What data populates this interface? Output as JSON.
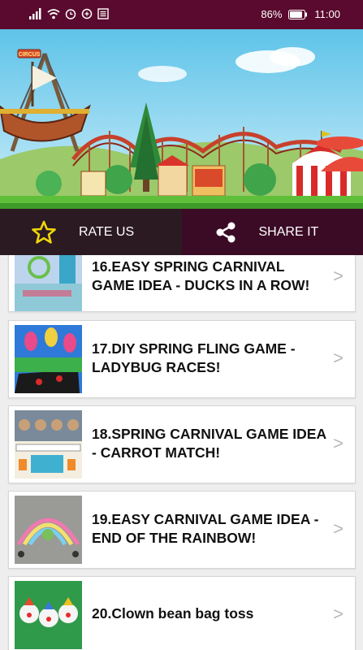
{
  "status_bar": {
    "battery": "86%",
    "time": "11:00"
  },
  "banner": {
    "sign_text": "CIRCUS"
  },
  "actions": {
    "rate_label": "RATE US",
    "share_label": "SHARE IT"
  },
  "items": [
    {
      "title": "16.EASY SPRING CARNIVAL GAME IDEA - DUCKS IN A ROW!",
      "chevron": ">"
    },
    {
      "title": "17.DIY SPRING FLING GAME - LADYBUG RACES!",
      "chevron": ">"
    },
    {
      "title": "18.SPRING CARNIVAL GAME IDEA - CARROT MATCH!",
      "chevron": ">"
    },
    {
      "title": "19.EASY CARNIVAL GAME IDEA - END OF THE RAINBOW!",
      "chevron": ">"
    },
    {
      "title": "20.Clown bean bag toss",
      "chevron": ">"
    }
  ],
  "icons": {
    "rate": "star-outline-icon",
    "share": "share-icon"
  },
  "colors": {
    "status_bar": "#5a0a2e",
    "rate_bg": "#2b1a22",
    "share_bg": "#3b0b26",
    "star": "#f0d60a"
  }
}
